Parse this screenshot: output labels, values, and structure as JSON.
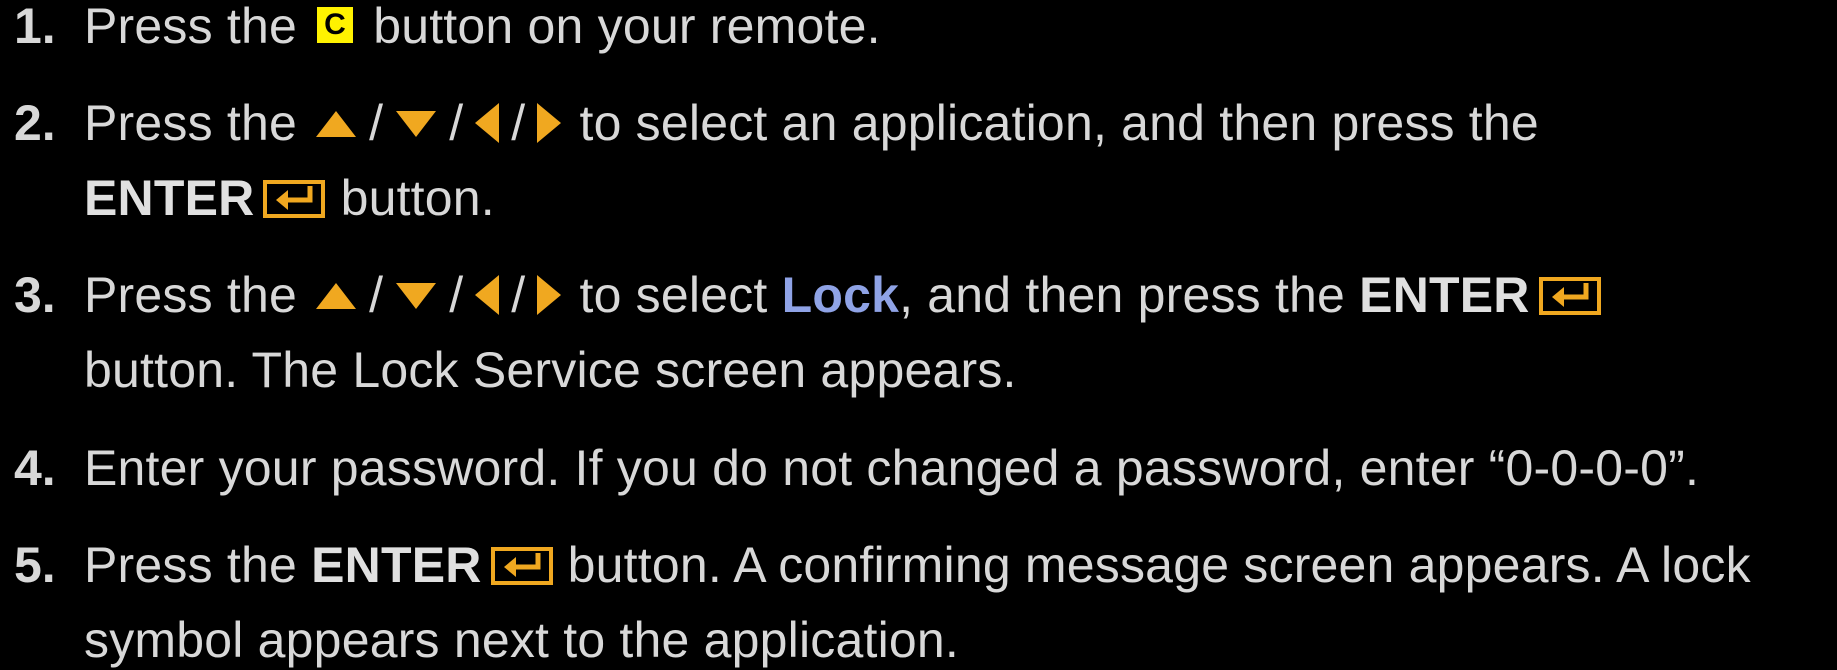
{
  "steps": [
    {
      "number": "1.",
      "line1": {
        "a": "Press the",
        "key": "C",
        "b": "button on your remote."
      }
    },
    {
      "number": "2.",
      "line1": {
        "a": "Press the",
        "sep1": "/",
        "sep2": "/",
        "sep3": "/",
        "b": "to select an application, and then press the"
      },
      "line2": {
        "enter": "ENTER",
        "b": "button."
      }
    },
    {
      "number": "3.",
      "line1": {
        "a": "Press the",
        "sep1": "/",
        "sep2": "/",
        "sep3": "/",
        "b": "to select",
        "lock": "Lock",
        "c": ", and then press the",
        "enter": "ENTER"
      },
      "line2": {
        "a": "button. The Lock Service screen appears."
      }
    },
    {
      "number": "4.",
      "line1": {
        "a": "Enter your password. If you do not changed a password, enter “0-0-0-0”."
      }
    },
    {
      "number": "5.",
      "line1": {
        "a": "Press the",
        "enter": "ENTER",
        "b": "button. A confirming message screen appears. A lock"
      },
      "line2": {
        "a": "symbol appears next to the application."
      }
    }
  ],
  "colors": {
    "background": "#000000",
    "text": "#d8d8d8",
    "accent_arrow": "#f0a820",
    "highlight_lock": "#8fa3e6",
    "c_key": "#fff200"
  },
  "icons": [
    "up-arrow-icon",
    "down-arrow-icon",
    "left-arrow-icon",
    "right-arrow-icon",
    "enter-icon"
  ]
}
